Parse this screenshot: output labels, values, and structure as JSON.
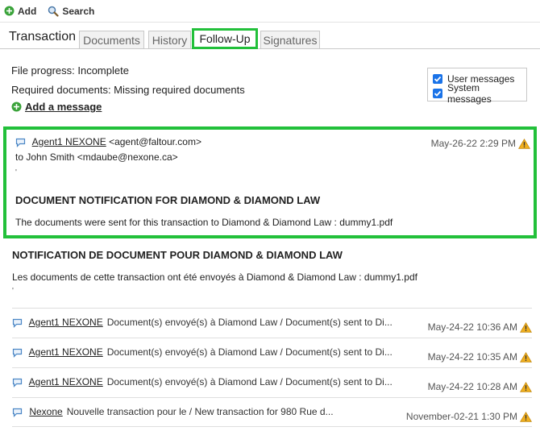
{
  "toolbar": {
    "add_label": "Add",
    "search_label": "Search"
  },
  "tabs": {
    "title": "Transaction",
    "items": [
      {
        "label": "Documents"
      },
      {
        "label": "History"
      },
      {
        "label": "Follow-Up"
      },
      {
        "label": "Signatures"
      }
    ]
  },
  "info": {
    "file_progress": "File progress: Incomplete",
    "required_docs": "Required documents: Missing required documents",
    "add_message": "Add a message"
  },
  "filters": {
    "user_messages": "User messages",
    "system_messages": "System messages"
  },
  "message": {
    "sender": "Agent1 NEXONE",
    "sender_email": "<agent@faltour.com>",
    "to_prefix": "to",
    "recipient": "John Smith <mdaube@nexone.ca>",
    "date": "May-26-22 2:29 PM",
    "quote": "'",
    "subject_en": "DOCUMENT NOTIFICATION FOR DIAMOND & DIAMOND LAW",
    "body_en": "The documents were sent for this transaction to Diamond & Diamond Law : dummy1.pdf",
    "subject_fr": "NOTIFICATION DE DOCUMENT POUR DIAMOND & DIAMOND LAW",
    "body_fr": "Les documents de cette transaction ont été envoyés à Diamond & Diamond Law : dummy1.pdf",
    "quote_end": "'"
  },
  "list": [
    {
      "sender": "Agent1 NEXONE",
      "snippet": "Document(s) envoyé(s) à Diamond Law / Document(s) sent to Di...",
      "date": "May-24-22 10:36 AM"
    },
    {
      "sender": "Agent1 NEXONE",
      "snippet": "Document(s) envoyé(s) à Diamond Law / Document(s) sent to Di...",
      "date": "May-24-22 10:35 AM"
    },
    {
      "sender": "Agent1 NEXONE",
      "snippet": "Document(s) envoyé(s) à Diamond Law / Document(s) sent to Di...",
      "date": "May-24-22 10:28 AM"
    },
    {
      "sender": "Nexone",
      "snippet": "Nouvelle transaction pour le / New transaction for 980 Rue d...",
      "date": "November-02-21 1:30 PM"
    }
  ],
  "colors": {
    "accent_green": "#22c03a",
    "checkbox_blue": "#1a73e8",
    "warning": "#f2b01e"
  }
}
